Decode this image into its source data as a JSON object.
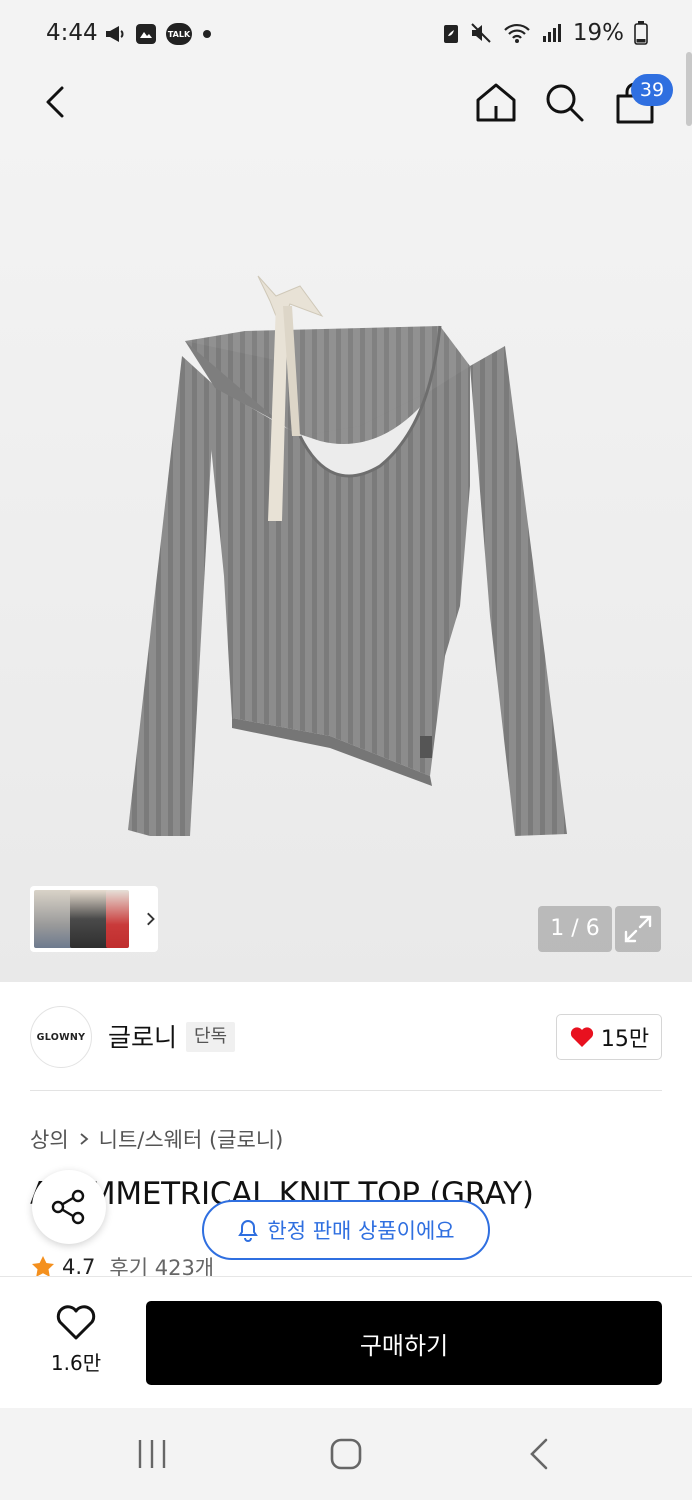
{
  "status_bar": {
    "time": "4:44",
    "battery_percent": "19%",
    "icons": [
      "megaphone-icon",
      "gallery-icon",
      "talk-icon",
      "dot-icon",
      "battery-saver-icon",
      "mute-icon",
      "wifi-icon",
      "signal-icon",
      "battery-icon"
    ],
    "talk_label": "TALK"
  },
  "top_nav": {
    "cart_count": "39",
    "icons": [
      "back-icon",
      "home-icon",
      "search-icon",
      "cart-icon"
    ]
  },
  "gallery": {
    "counter": "1 / 6",
    "current_index": 1,
    "total_images": 6,
    "icons": [
      "expand-icon",
      "chevron-right-icon"
    ]
  },
  "brand": {
    "logo_text": "GLOWNY",
    "name": "글로니",
    "tag": "단독",
    "likes": "15만"
  },
  "product": {
    "breadcrumb": [
      "상의",
      "니트/스웨터 (글로니)"
    ],
    "title": "ASYMMETRICAL KNIT TOP (GRAY)",
    "rating": "4.7",
    "reviews": "후기 423개"
  },
  "floating": {
    "limited_label": "한정 판매 상품이에요"
  },
  "bottom_bar": {
    "wishlist_count": "1.6만",
    "buy_label": "구매하기"
  },
  "colors": {
    "accent_blue": "#2f6fe0",
    "heart_red": "#e8111f",
    "star_orange": "#f4901e",
    "buy_bg": "#000000",
    "knit_gray": "#8a8a8a"
  }
}
